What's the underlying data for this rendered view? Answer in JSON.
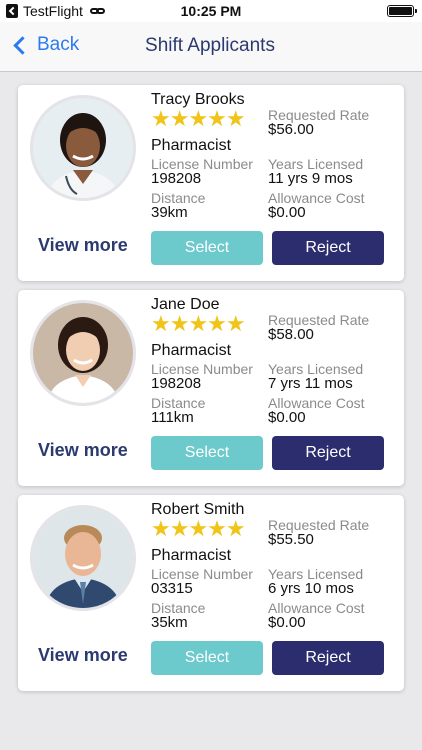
{
  "status_bar": {
    "app": "TestFlight",
    "time": "10:25 PM"
  },
  "nav": {
    "back_label": "Back",
    "title": "Shift Applicants"
  },
  "labels": {
    "requested_rate": "Requested Rate",
    "license_number": "License Number",
    "years_licensed": "Years Licensed",
    "distance": "Distance",
    "allowance_cost": "Allowance Cost",
    "view_more": "View more",
    "select": "Select",
    "reject": "Reject"
  },
  "applicants": [
    {
      "name": "Tracy Brooks",
      "rating": 4.5,
      "stars": "★★★★★",
      "role": "Pharmacist",
      "requested_rate": "$56.00",
      "license_number": "198208",
      "years_licensed": "11 yrs 9 mos",
      "distance": "39km",
      "allowance_cost": "$0.00"
    },
    {
      "name": "Jane Doe",
      "rating": 5,
      "stars": "★★★★★",
      "role": "Pharmacist",
      "requested_rate": "$58.00",
      "license_number": "198208",
      "years_licensed": "7 yrs 11 mos",
      "distance": "111km",
      "allowance_cost": "$0.00"
    },
    {
      "name": "Robert Smith",
      "rating": 4.5,
      "stars": "★★★★★",
      "role": "Pharmacist",
      "requested_rate": "$55.50",
      "license_number": "03315",
      "years_licensed": "6 yrs 10 mos",
      "distance": "35km",
      "allowance_cost": "$0.00"
    }
  ],
  "colors": {
    "accent": "#2b7bf0",
    "navy": "#2b3a6f",
    "select": "#6cc9cc",
    "reject": "#2b2d6e",
    "star": "#f0c419"
  }
}
